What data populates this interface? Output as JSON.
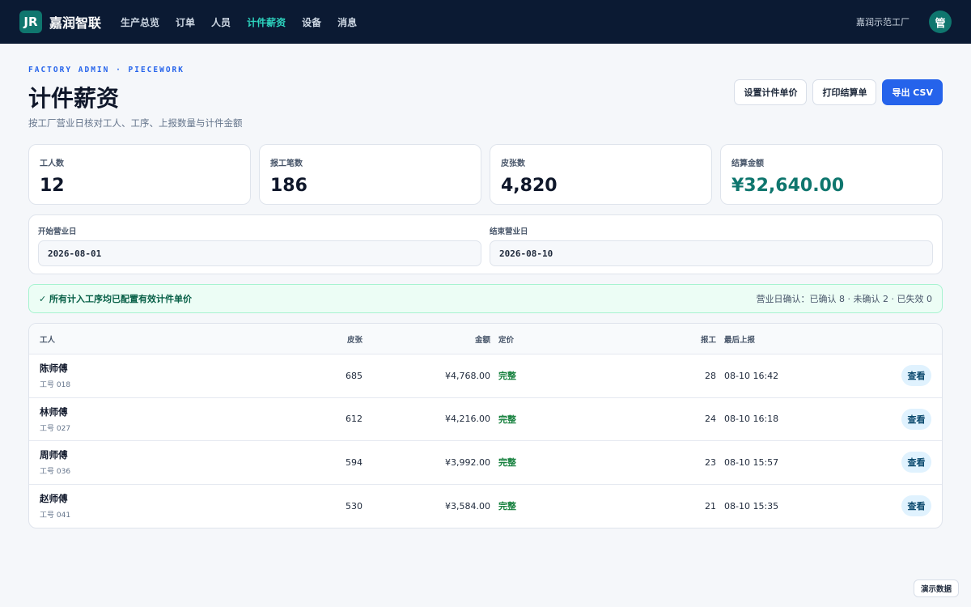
{
  "topbar": {
    "logo_text": "JR",
    "brand": "嘉润智联",
    "nav": [
      "生产总览",
      "订单",
      "人员",
      "计件薪资",
      "设备",
      "消息"
    ],
    "active_nav": "计件薪资",
    "factory": "嘉润示范工厂",
    "avatar": "管",
    "colors": {
      "background": "#0b1a33",
      "active": "#2dd4bf",
      "logo": "#0f766e"
    }
  },
  "header": {
    "eyebrow": "FACTORY ADMIN · PIECEWORK",
    "title": "计件薪资",
    "subtitle": "按工厂营业日核对工人、工序、上报数量与计件金额",
    "buttons": {
      "set_price": "设置计件单价",
      "print": "打印结算单",
      "export": "导出 CSV"
    }
  },
  "stats": [
    {
      "label": "工人数",
      "value": "12"
    },
    {
      "label": "报工笔数",
      "value": "186"
    },
    {
      "label": "皮张数",
      "value": "4,820"
    },
    {
      "label": "结算金额",
      "value": "¥32,640.00"
    }
  ],
  "filters": {
    "start_label": "开始营业日",
    "start_value": "2026-08-01",
    "end_label": "结束营业日",
    "end_value": "2026-08-10"
  },
  "notice": {
    "message": "✓ 所有计入工序均已配置有效计件单价",
    "summary": "营业日确认：已确认 8 · 未确认 2 · 已失效 0"
  },
  "table": {
    "headers": {
      "worker": "工人",
      "hides": "皮张",
      "amount": "金额",
      "pricing": "定价",
      "reports": "报工",
      "last": "最后上报"
    },
    "rows": [
      {
        "name": "陈师傅",
        "id": "工号 018",
        "hides": "685",
        "amount": "¥4,768.00",
        "pricing": "完整",
        "reports": "28",
        "last": "08-10 16:42",
        "action": "查看"
      },
      {
        "name": "林师傅",
        "id": "工号 027",
        "hides": "612",
        "amount": "¥4,216.00",
        "pricing": "完整",
        "reports": "24",
        "last": "08-10 16:18",
        "action": "查看"
      },
      {
        "name": "周师傅",
        "id": "工号 036",
        "hides": "594",
        "amount": "¥3,992.00",
        "pricing": "完整",
        "reports": "23",
        "last": "08-10 15:57",
        "action": "查看"
      },
      {
        "name": "赵师傅",
        "id": "工号 041",
        "hides": "530",
        "amount": "¥3,584.00",
        "pricing": "完整",
        "reports": "21",
        "last": "08-10 15:35",
        "action": "查看"
      }
    ]
  },
  "demo_badge": "演示数据",
  "colors": {
    "primary": "#2563eb",
    "money": "#0f766e",
    "success": "#15803d"
  }
}
